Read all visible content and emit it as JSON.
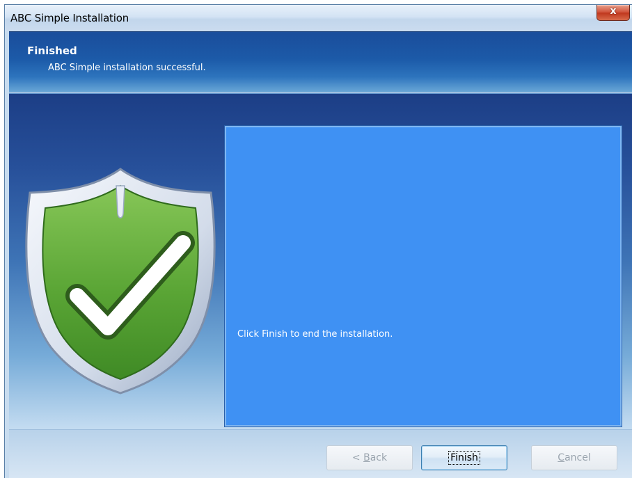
{
  "window": {
    "title": "ABC Simple Installation",
    "close_glyph": "x"
  },
  "header": {
    "title": "Finished",
    "subtitle": "ABC Simple installation successful."
  },
  "graphic": {
    "icon": "shield-check-icon",
    "colors": {
      "shield_green": "#5aa535",
      "shield_rim": "#dfe6f1",
      "check": "#ffffff"
    }
  },
  "panel": {
    "message": "Click Finish to end the installation.",
    "background": "#3f91f3"
  },
  "buttons": {
    "back": {
      "prefix": "< ",
      "mnemonic": "B",
      "rest": "ack",
      "enabled": false
    },
    "finish": {
      "label": "Finish",
      "enabled": true
    },
    "cancel": {
      "mnemonic": "C",
      "rest": "ancel",
      "enabled": false
    }
  }
}
